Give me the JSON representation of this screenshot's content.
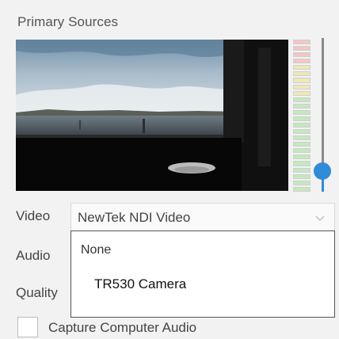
{
  "section_title": "Primary Sources",
  "video": {
    "label": "Video",
    "selected": "NewTek NDI Video",
    "chevron_icon": "chevron-down-icon"
  },
  "audio": {
    "label": "Audio"
  },
  "quality": {
    "label": "Quality"
  },
  "dropdown": {
    "options": [
      "None",
      "TR530 Camera"
    ]
  },
  "capture_audio": {
    "label": "Capture Computer Audio",
    "checked": false
  },
  "volume": {
    "level": 0.1
  },
  "meter": {
    "red_segments": 4,
    "yellow_segments": 5,
    "green_segments": 15,
    "colors": {
      "red": "#f2c6c6",
      "yellow": "#eee8b8",
      "green": "#c5e8bf"
    }
  },
  "accent_color": "#2f8cd8"
}
